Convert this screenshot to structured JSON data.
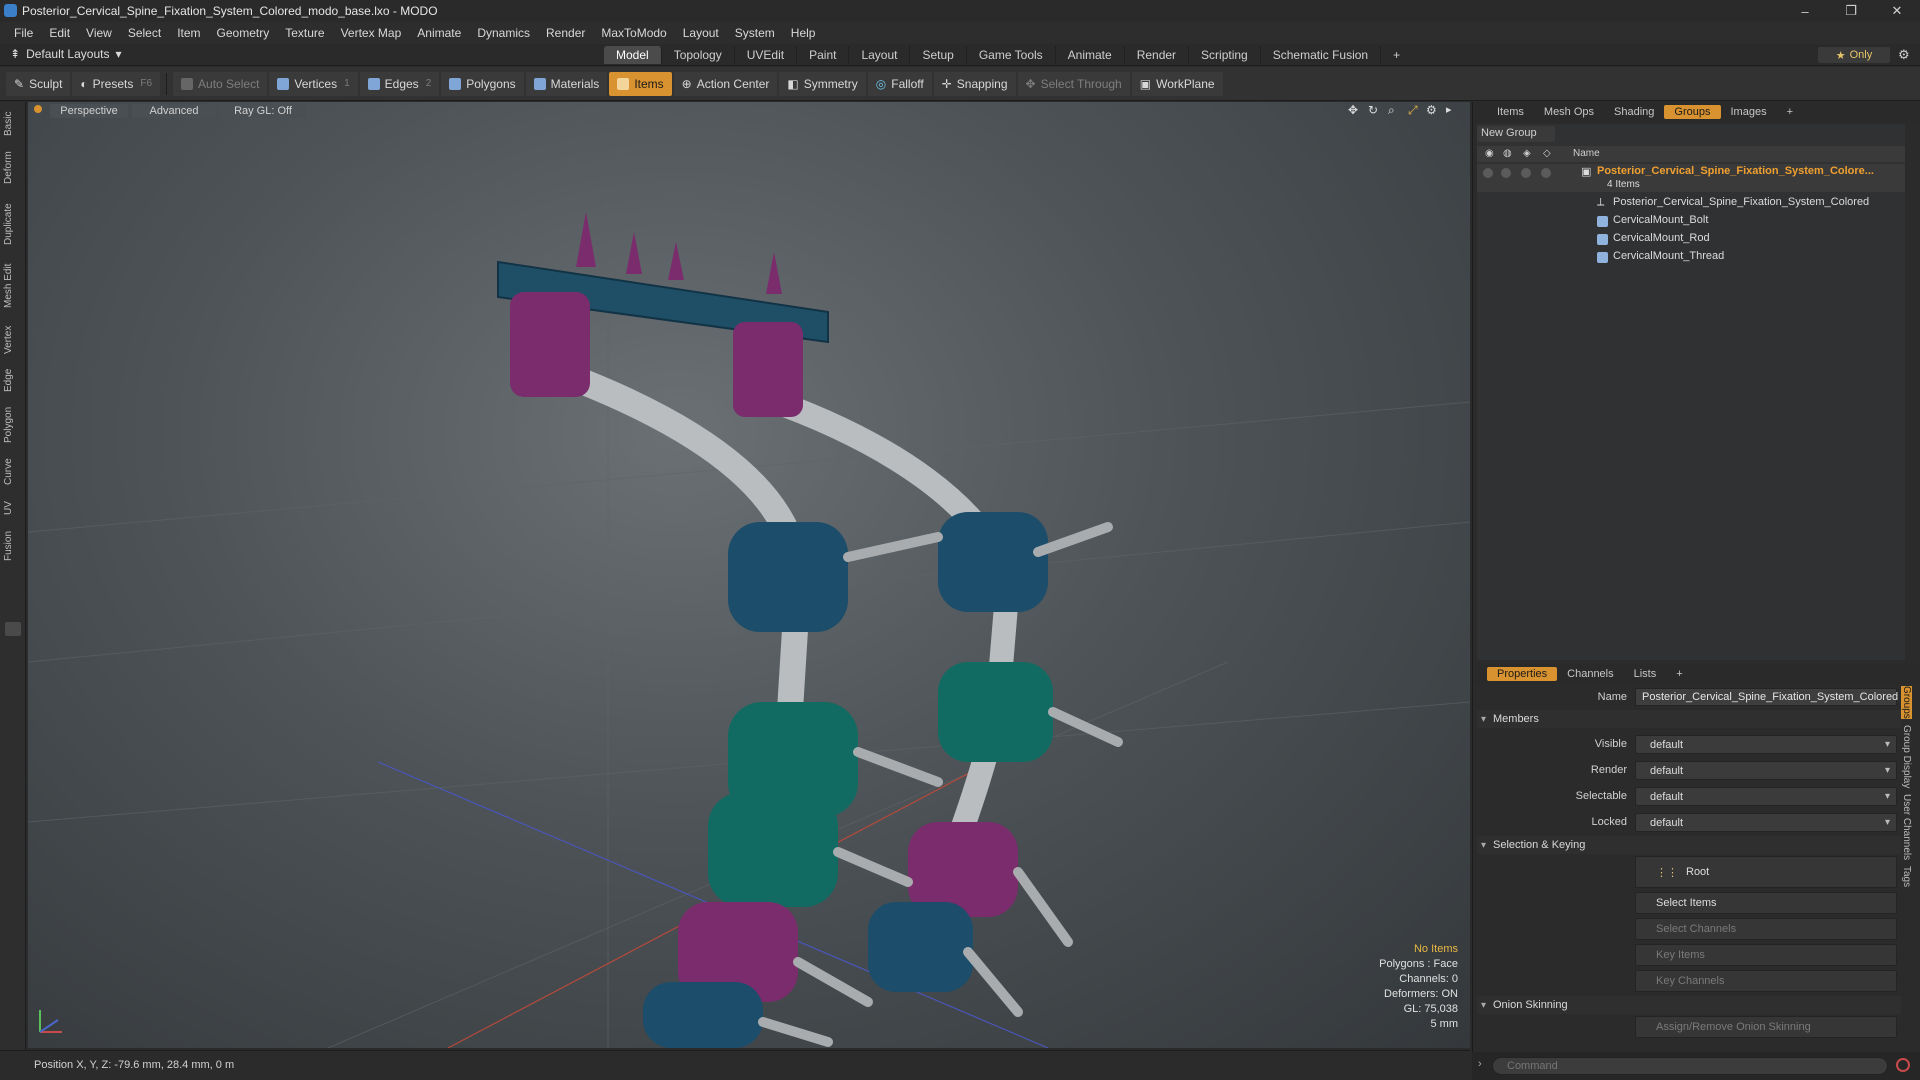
{
  "window": {
    "title": "Posterior_Cervical_Spine_Fixation_System_Colored_modo_base.lxo - MODO",
    "minimize": "–",
    "restore": "❐",
    "close": "✕"
  },
  "menu": [
    "File",
    "Edit",
    "View",
    "Select",
    "Item",
    "Geometry",
    "Texture",
    "Vertex Map",
    "Animate",
    "Dynamics",
    "Render",
    "MaxToModo",
    "Layout",
    "System",
    "Help"
  ],
  "layouts": {
    "label": "Default Layouts",
    "arrow": "▾"
  },
  "main_tabs": [
    "Model",
    "Topology",
    "UVEdit",
    "Paint",
    "Layout",
    "Setup",
    "Game Tools",
    "Animate",
    "Render",
    "Scripting",
    "Schematic Fusion"
  ],
  "main_tabs_add": "+",
  "only_button": {
    "star": "★",
    "label": "Only"
  },
  "toolbar": {
    "sculpt": "Sculpt",
    "presets": "Presets",
    "presets_key": "F6",
    "auto_select": "Auto Select",
    "vertices": "Vertices",
    "vertices_key": "1",
    "edges": "Edges",
    "edges_key": "2",
    "polygons": "Polygons",
    "materials": "Materials",
    "items": "Items",
    "action_center": "Action Center",
    "symmetry": "Symmetry",
    "falloff": "Falloff",
    "snapping": "Snapping",
    "select_through": "Select Through",
    "workplane": "WorkPlane"
  },
  "left_tabs": [
    "Basic",
    "Deform",
    "Duplicate",
    "Mesh Edit",
    "Vertex",
    "Edge",
    "Polygon",
    "Curve",
    "UV",
    "Fusion"
  ],
  "viewport": {
    "tab_perspective": "Perspective",
    "tab_advanced": "Advanced",
    "tab_raygl": "Ray GL: Off",
    "info": {
      "no_items": "No Items",
      "polygons": "Polygons : Face",
      "channels": "Channels: 0",
      "deformers": "Deformers: ON",
      "gl": "GL: 75,038",
      "scale": "5 mm"
    }
  },
  "status": {
    "position": "Position X, Y, Z:  -79.6 mm, 28.4 mm, 0 m"
  },
  "top_panel": {
    "tabs": [
      "Items",
      "Mesh Ops",
      "Shading",
      "Groups",
      "Images"
    ],
    "active": "Groups",
    "add": "+",
    "new_group": "New Group",
    "col_name": "Name",
    "group": {
      "name": "Posterior_Cervical_Spine_Fixation_System_Colore...",
      "count": "4 Items",
      "children": [
        "Posterior_Cervical_Spine_Fixation_System_Colored",
        "CervicalMount_Bolt",
        "CervicalMount_Rod",
        "CervicalMount_Thread"
      ]
    }
  },
  "props_panel": {
    "tabs": [
      "Properties",
      "Channels",
      "Lists"
    ],
    "add": "+",
    "name_label": "Name",
    "name_value": "Posterior_Cervical_Spine_Fixation_System_Colored",
    "members": "Members",
    "visible_label": "Visible",
    "render_label": "Render",
    "selectable_label": "Selectable",
    "locked_label": "Locked",
    "default": "default",
    "sel_keying": "Selection & Keying",
    "root": "Root",
    "select_items": "Select Items",
    "select_channels": "Select Channels",
    "key_items": "Key Items",
    "key_channels": "Key Channels",
    "onion": "Onion Skinning",
    "assign_onion": "Assign/Remove Onion Skinning",
    "right_vtabs": [
      "Groups",
      "Group Display",
      "User Channels",
      "Tags"
    ]
  },
  "command": {
    "placeholder": "Command"
  }
}
